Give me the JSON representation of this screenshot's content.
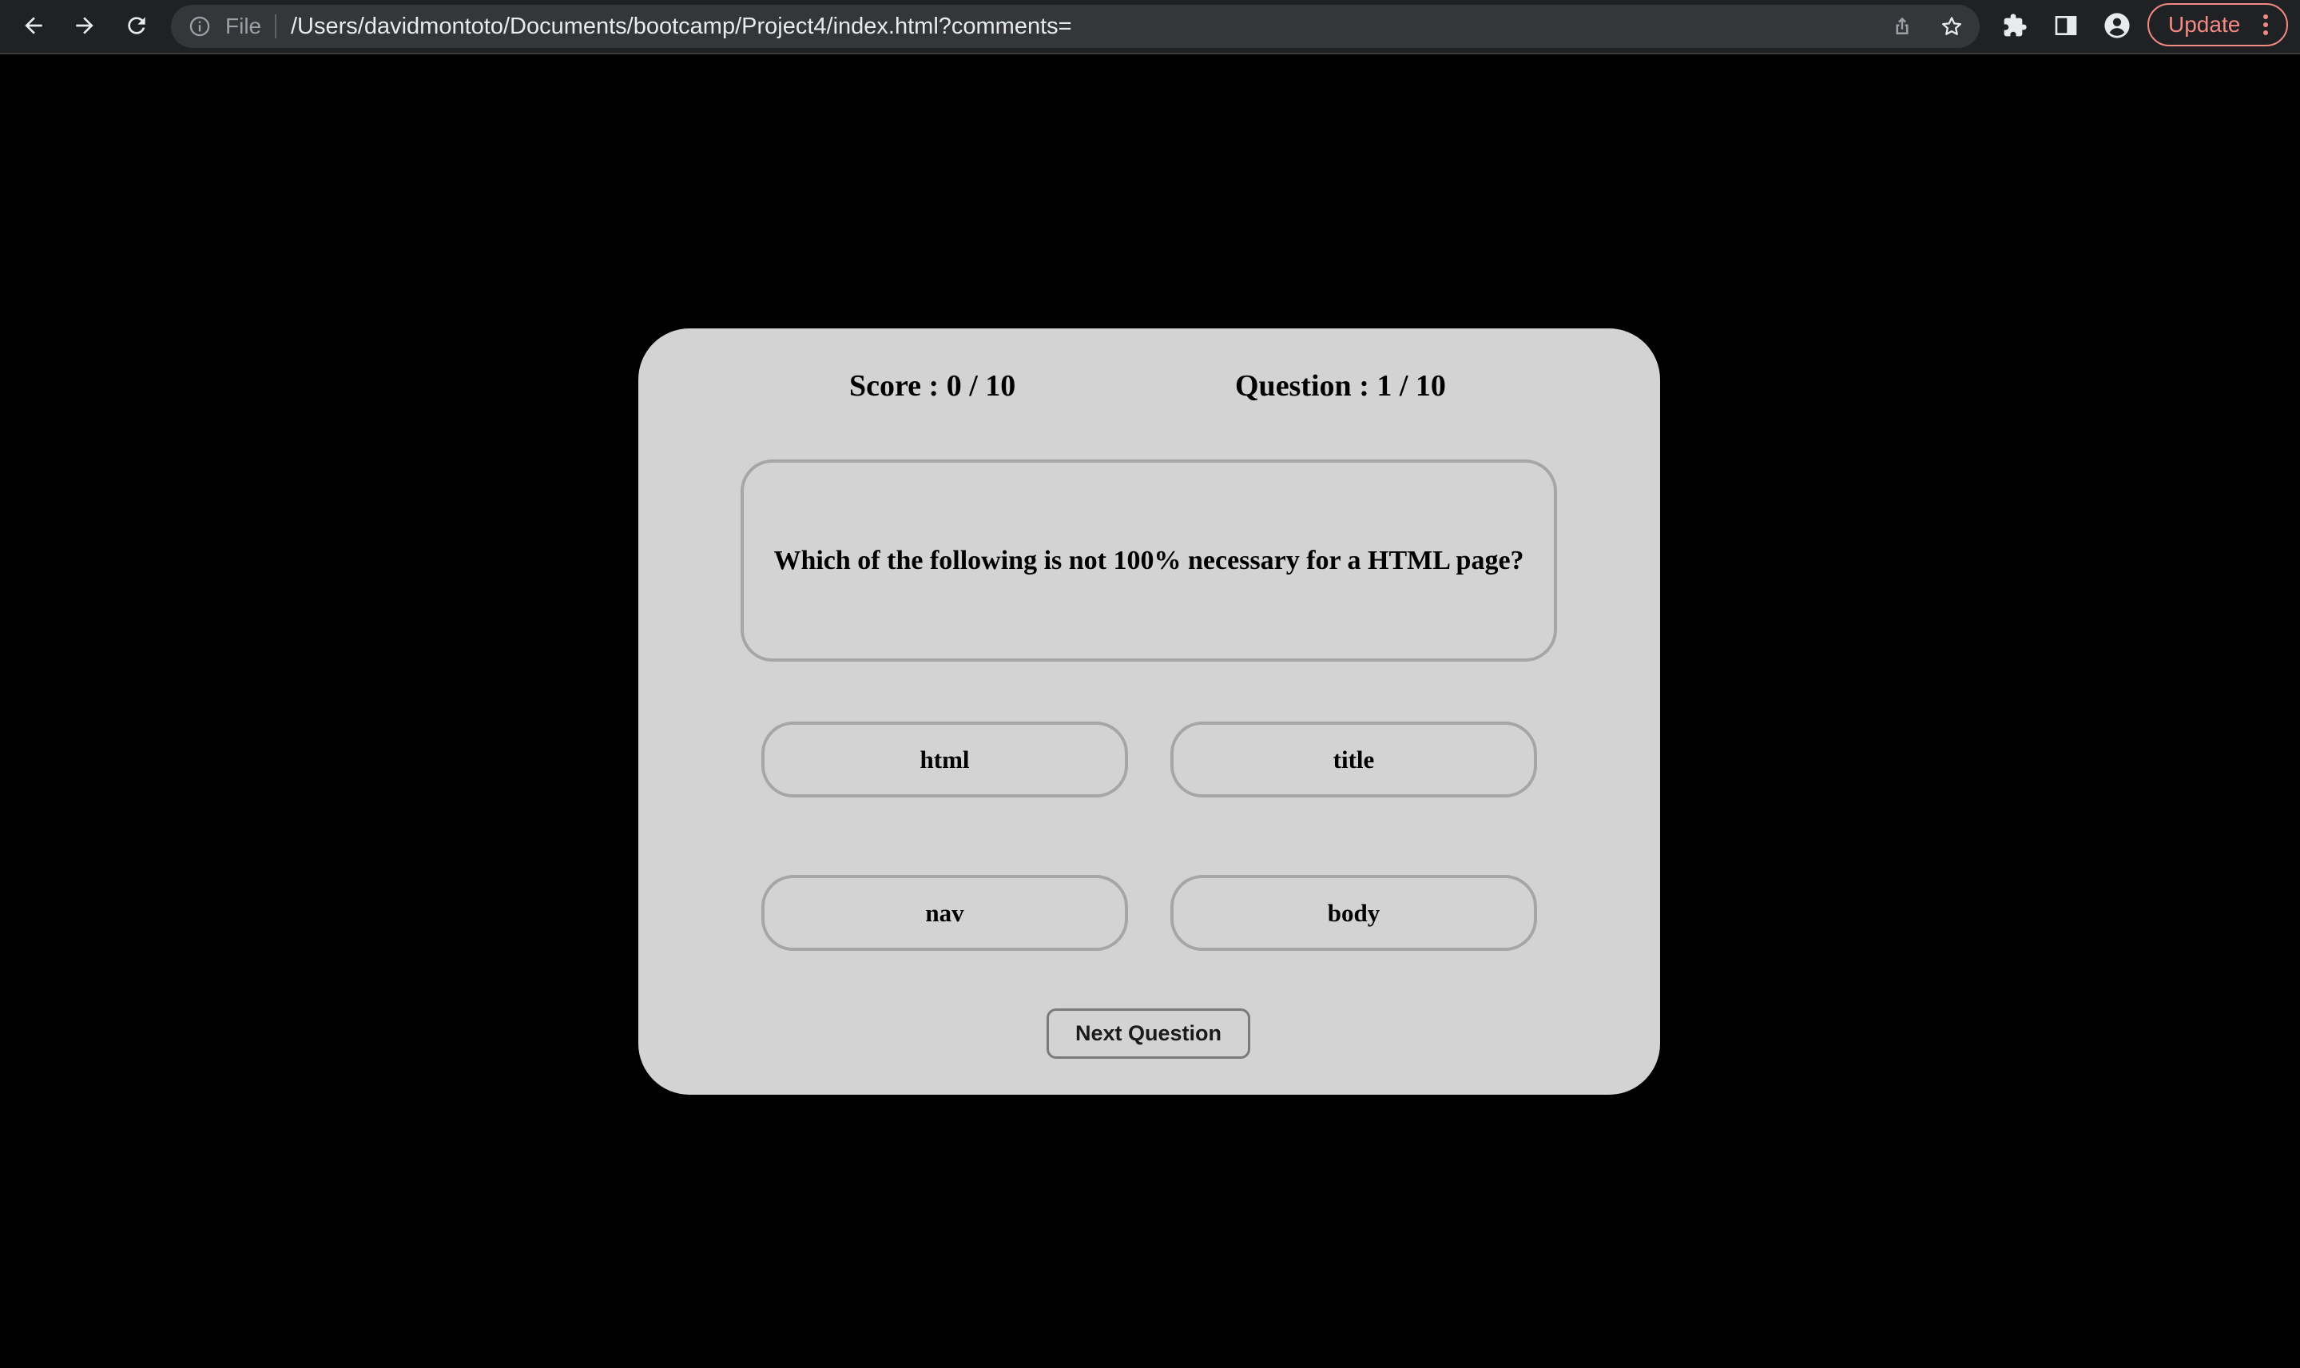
{
  "browser": {
    "omnibox": {
      "scheme_label": "File",
      "url": "/Users/davidmontoto/Documents/bootcamp/Project4/index.html?comments="
    },
    "update_label": "Update",
    "icons": [
      "back-icon",
      "forward-icon",
      "reload-icon",
      "info-icon",
      "share-icon",
      "star-icon",
      "extensions-icon",
      "side-panel-icon",
      "profile-icon",
      "more-icon"
    ],
    "colors": {
      "toolbar": "#202124",
      "omnibox": "#35363a",
      "update_accent": "#f28b82"
    }
  },
  "quiz": {
    "score_label": "Score : 0 / 10",
    "question_counter_label": "Question : 1 / 10",
    "question": "Which of the following is not 100% necessary for a HTML page?",
    "answers": [
      "html",
      "title",
      "nav",
      "body"
    ],
    "next_label": "Next Question",
    "colors": {
      "page_background": "#000000",
      "card": "#d3d3d3",
      "border": "#a6a6a6"
    }
  }
}
